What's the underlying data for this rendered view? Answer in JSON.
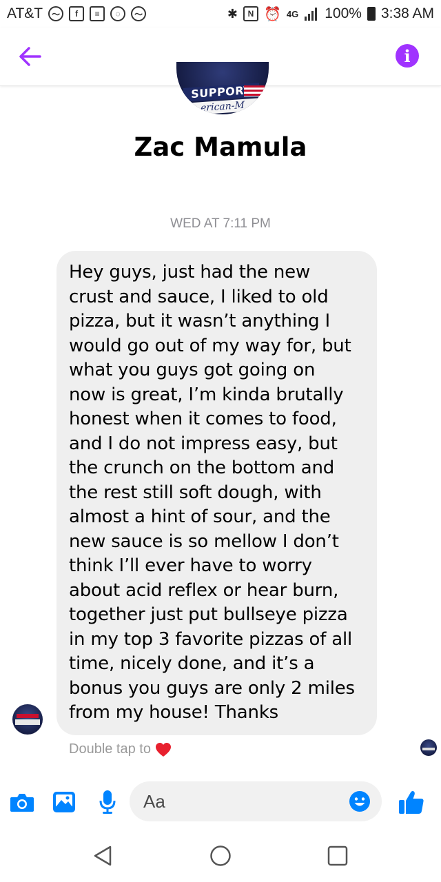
{
  "status_bar": {
    "carrier": "AT&T",
    "network_badge": "4G",
    "battery": "100%",
    "time": "3:38 AM",
    "left_icons": [
      "messenger-icon",
      "facebook-icon",
      "news-icon",
      "app-icon",
      "messenger-icon"
    ],
    "right_icons": [
      "bluetooth-icon",
      "nfc-icon",
      "alarm-icon",
      "signal-icon",
      "battery-icon"
    ]
  },
  "header": {
    "back_icon": "arrow-left-icon",
    "info_icon": "info-icon",
    "accent_color": "#a033ff"
  },
  "profile": {
    "avatar_banner_text": "SUPPORT",
    "avatar_script_text": "erican-M",
    "name": "Zac Mamula"
  },
  "conversation": {
    "timestamp": "WED AT 7:11 PM",
    "message": "Hey guys, just had the new\ncrust and sauce, I liked to old\npizza, but it wasn’t anything I\nwould go out of my way for, but\nwhat you guys got going on\nnow is great, I’m kinda brutally\nhonest when it comes to food,\nand I do not impress easy, but\nthe crunch on the bottom and\nthe rest still soft dough, with\nalmost a hint of sour, and the\nnew sauce is so mellow I don’t\nthink I’ll ever have to worry\nabout acid reflex or hear burn,\ntogether just put bullseye pizza\nin my top 3 favorite pizzas of all\ntime, nicely done, and it’s a\nbonus you guys are only 2 miles\nfrom my house! Thanks",
    "hint": "Double tap to"
  },
  "composer": {
    "placeholder": "Aa",
    "icon_color": "#0084ff"
  },
  "nav_bar": {
    "buttons": [
      "back-triangle-icon",
      "home-circle-icon",
      "recents-square-icon"
    ]
  }
}
